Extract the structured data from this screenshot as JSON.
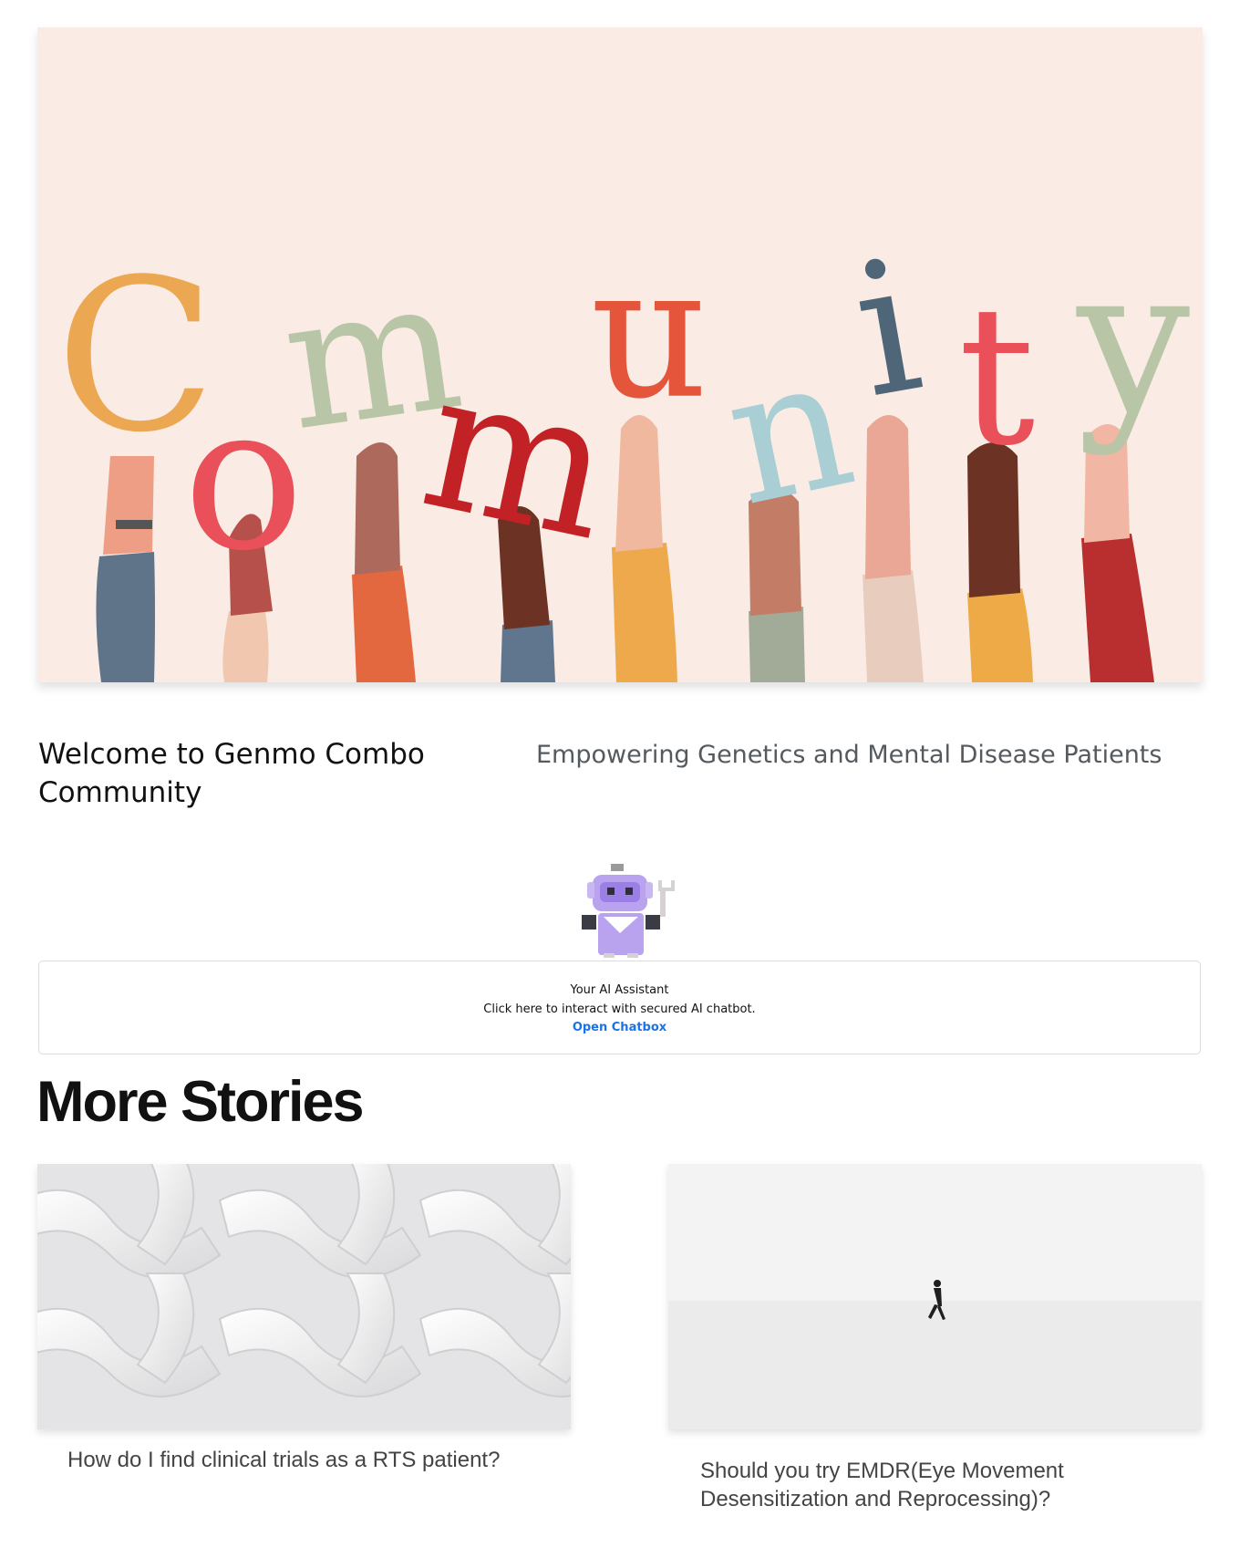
{
  "hero": {
    "word": [
      "C",
      "o",
      "m",
      "m",
      "u",
      "n",
      "i",
      "t",
      "y"
    ]
  },
  "welcome": {
    "title": "Welcome to Genmo Combo Community",
    "tagline": "Empowering Genetics and Mental Disease Patients"
  },
  "assistant": {
    "heading": "Your AI Assistant",
    "description": "Click here to interact with secured AI chatbot.",
    "open_label": "Open Chatbox",
    "link_color": "#1a73e8"
  },
  "stories": {
    "heading": "More Stories",
    "items": [
      {
        "title": "How do I find clinical trials as a RTS patient?"
      },
      {
        "title": "Should you try EMDR(Eye Movement Desensitization and Reprocessing)?"
      }
    ]
  },
  "colors": {
    "hero_bg": "#faece4",
    "tagline": "#555a5e",
    "story_title": "#444444"
  }
}
